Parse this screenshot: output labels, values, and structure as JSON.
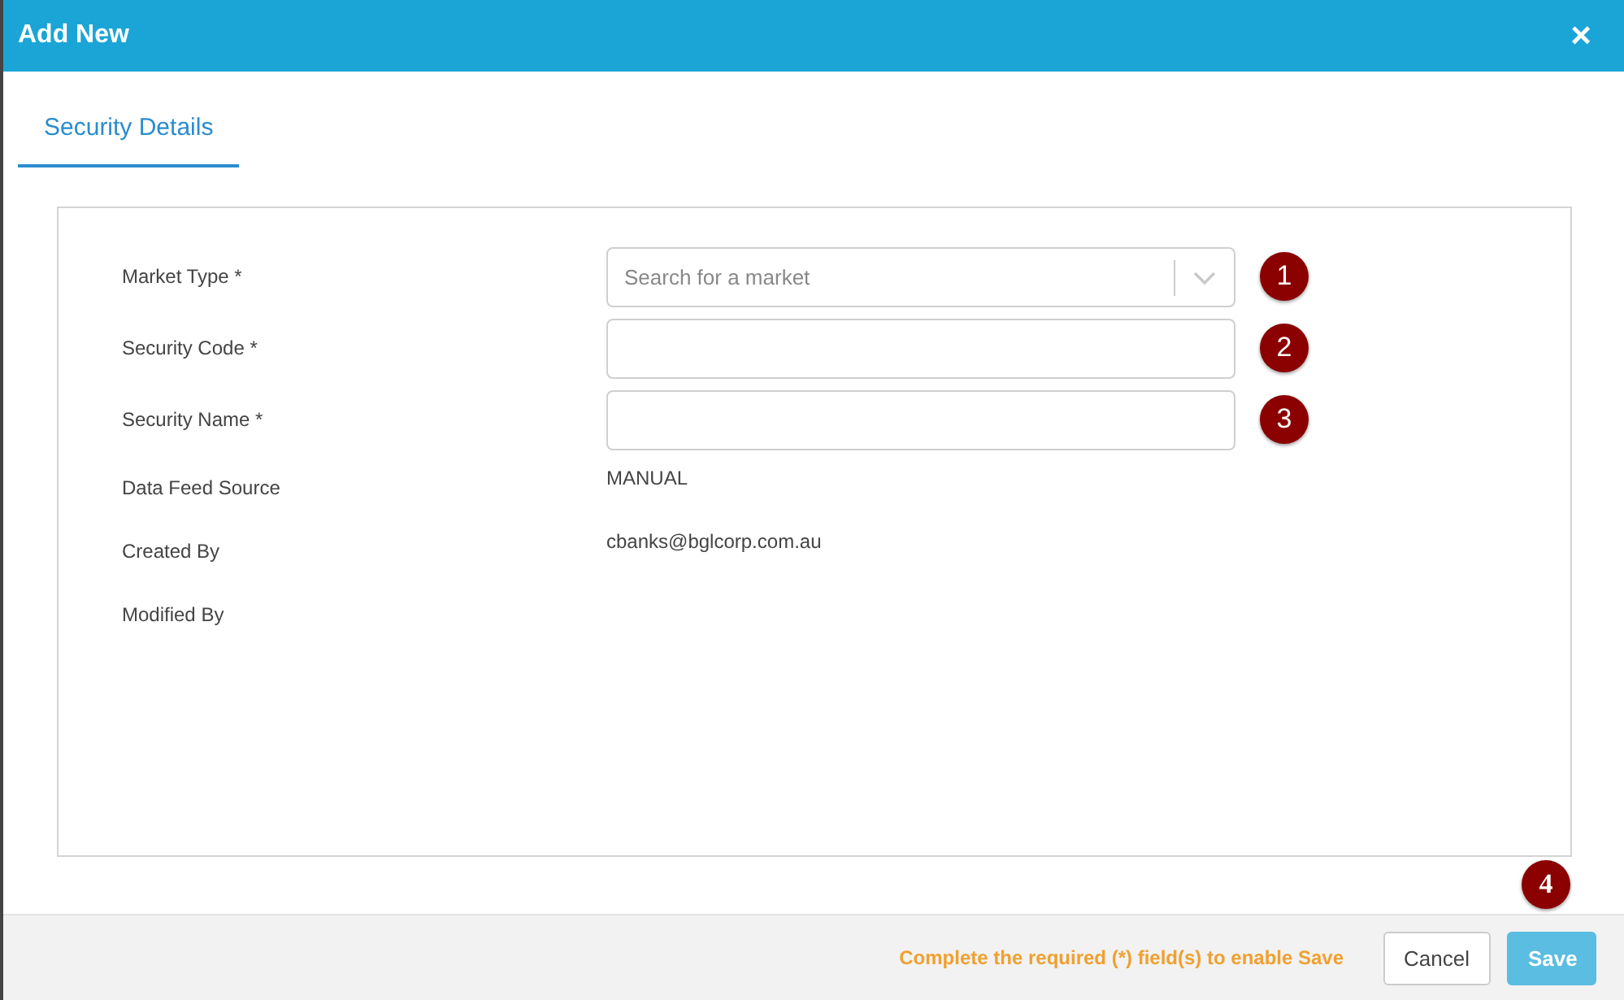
{
  "window": {
    "title": "Add New",
    "close": "×"
  },
  "tabs": [
    {
      "label": "Security Details",
      "selected": true
    }
  ],
  "fields": [
    {
      "kind": "select",
      "label": "Market Type *",
      "placeholder": "Search for a market",
      "badge": "1"
    },
    {
      "kind": "input",
      "label": "Security Code *",
      "badge": "2"
    },
    {
      "kind": "input",
      "label": "Security Name *",
      "badge": "3"
    },
    {
      "kind": "text",
      "label": "Data Feed Source",
      "value": "MANUAL"
    },
    {
      "kind": "text",
      "label": "Created By",
      "value": "cbanks@bglcorp.com.au"
    },
    {
      "kind": "text",
      "label": "Modified By"
    }
  ],
  "footer_badge": "4",
  "footer": {
    "message": "Complete the required (*) field(s) to enable Save",
    "buttons": [
      {
        "kind": "secondary",
        "label": "Cancel",
        "disabled": false
      },
      {
        "kind": "primary",
        "label": "Save",
        "disabled": true
      }
    ]
  }
}
